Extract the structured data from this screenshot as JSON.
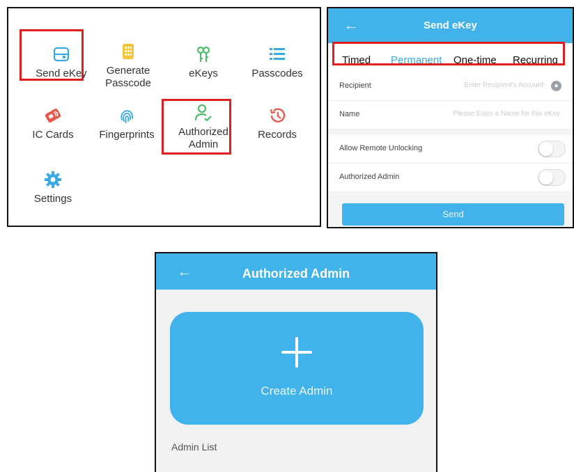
{
  "menu": {
    "items": [
      {
        "label": "Send eKey",
        "icon": "send-ekey-icon",
        "color": "#3aa9e3"
      },
      {
        "label": "Generate\nPasscode",
        "icon": "keypad-icon",
        "color": "#f4c43a"
      },
      {
        "label": "eKeys",
        "icon": "ekeys-icon",
        "color": "#4cbb6a"
      },
      {
        "label": "Passcodes",
        "icon": "passcodes-icon",
        "color": "#3aa9e3"
      },
      {
        "label": "IC Cards",
        "icon": "ic-card-icon",
        "color": "#e8574a"
      },
      {
        "label": "Fingerprints",
        "icon": "fingerprint-icon",
        "color": "#3aa9e3"
      },
      {
        "label": "Authorized\nAdmin",
        "icon": "authorized-admin-icon",
        "color": "#4cbb6a"
      },
      {
        "label": "Records",
        "icon": "records-icon",
        "color": "#e8574a"
      },
      {
        "label": "Settings",
        "icon": "gear-icon",
        "color": "#3aa9e3"
      }
    ]
  },
  "send_ekey": {
    "back": "←",
    "title": "Send eKey",
    "tabs": [
      "Timed",
      "Permanent",
      "One-time",
      "Recurring"
    ],
    "active_tab": "Permanent",
    "recipient": {
      "label": "Recipient",
      "placeholder": "Enter Recipient's Account"
    },
    "name": {
      "label": "Name",
      "placeholder": "Please Enter a Name for this eKey"
    },
    "allow_remote_unlocking": {
      "label": "Allow Remote Unlocking",
      "on": false
    },
    "authorized_admin": {
      "label": "Authorized Admin",
      "on": false
    },
    "send_label": "Send"
  },
  "authorized_admin": {
    "back": "←",
    "title": "Authorized Admin",
    "create_label": "Create Admin",
    "list_label": "Admin List"
  },
  "colors": {
    "accent": "#41b3ea",
    "highlight_box": "#e02020"
  }
}
